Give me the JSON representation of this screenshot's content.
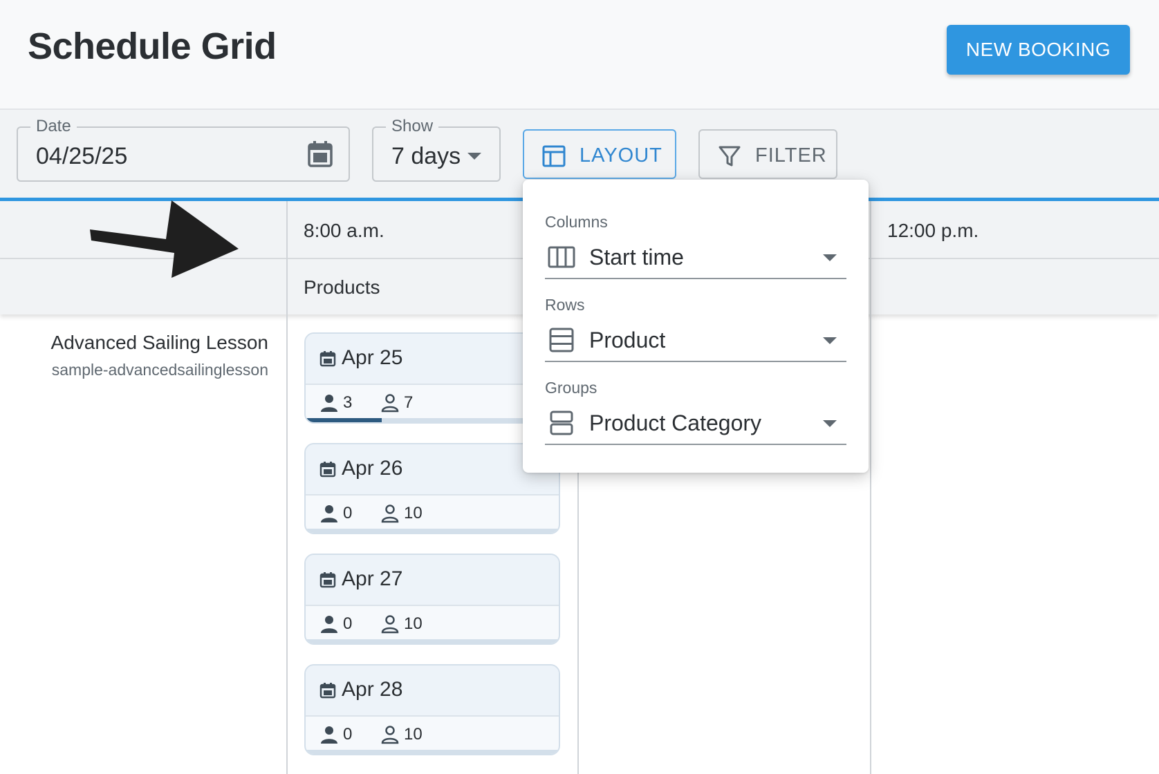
{
  "header": {
    "title": "Schedule Grid",
    "new_booking_label": "NEW BOOKING"
  },
  "toolbar": {
    "date": {
      "label": "Date",
      "value": "04/25/25"
    },
    "show": {
      "label": "Show",
      "value": "7 days"
    },
    "layout_label": "LAYOUT",
    "filter_label": "FILTER"
  },
  "grid": {
    "time_columns": [
      "8:00 a.m.",
      "12:00 p.m."
    ],
    "group_header": "Products",
    "product": {
      "name": "Advanced Sailing Lesson",
      "sku": "sample-advancedsailinglesson"
    },
    "slots": [
      {
        "date": "Apr 25",
        "booked": "3",
        "available": "7",
        "fill": 0.3
      },
      {
        "date": "Apr 26",
        "booked": "0",
        "available": "10",
        "fill": 0
      },
      {
        "date": "Apr 27",
        "booked": "0",
        "available": "10",
        "fill": 0
      },
      {
        "date": "Apr 28",
        "booked": "0",
        "available": "10",
        "fill": 0
      }
    ]
  },
  "layout_popover": {
    "columns": {
      "label": "Columns",
      "value": "Start time"
    },
    "rows": {
      "label": "Rows",
      "value": "Product"
    },
    "groups": {
      "label": "Groups",
      "value": "Product Category"
    }
  },
  "colors": {
    "accent": "#2f96e0",
    "booked_fill": "#2d5a80"
  }
}
